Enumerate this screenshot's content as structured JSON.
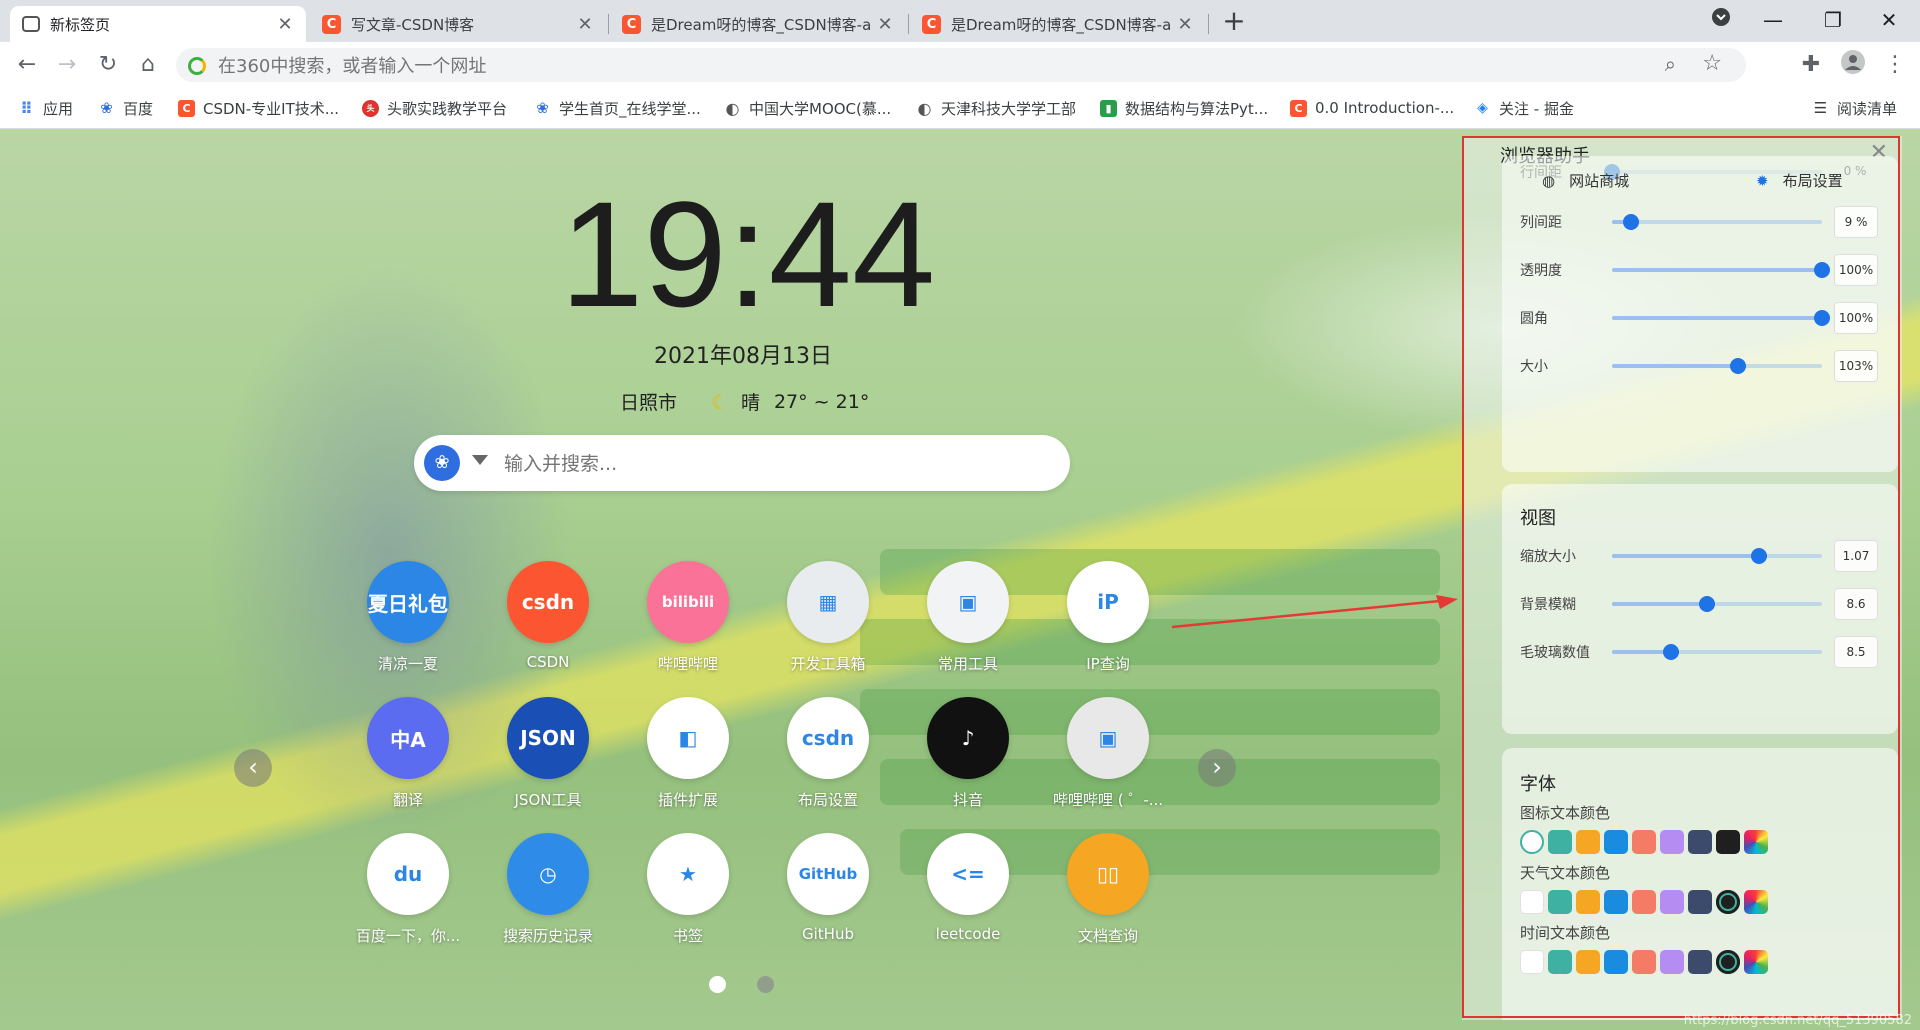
{
  "tabs": [
    {
      "title": "新标签页",
      "active": true
    },
    {
      "title": "写文章-CSDN博客",
      "active": false
    },
    {
      "title": "是Dream呀的博客_CSDN博客-a",
      "active": false
    },
    {
      "title": "是Dream呀的博客_CSDN博客-a",
      "active": false
    }
  ],
  "new_tab_label": "+",
  "toolbar": {
    "omnibox_placeholder": "在360中搜索，或者输入一个网址"
  },
  "bookmarks": [
    {
      "label": "应用",
      "icon": "apps-grid-icon",
      "color": "#4285f4"
    },
    {
      "label": "百度",
      "icon": "baidu-paw-icon",
      "color": "#2f6ee0"
    },
    {
      "label": "CSDN-专业IT技术...",
      "icon": "csdn-c-icon",
      "color": "#fc5531"
    },
    {
      "label": "头歌实践教学平台",
      "icon": "toge-icon",
      "color": "#e0322f"
    },
    {
      "label": "学生首页_在线学堂...",
      "icon": "paw-icon",
      "color": "#2f6ee0"
    },
    {
      "label": "中国大学MOOC(慕...",
      "icon": "mooc-icon",
      "color": "#555555"
    },
    {
      "label": "天津科技大学学工部",
      "icon": "globe-icon",
      "color": "#555555"
    },
    {
      "label": "数据结构与算法Pyt...",
      "icon": "book-icon",
      "color": "#2a9d4a"
    },
    {
      "label": "0.0 Introduction-...",
      "icon": "csdn-c-icon",
      "color": "#fc5531"
    },
    {
      "label": "关注 - 掘金",
      "icon": "juejin-icon",
      "color": "#1e80ff"
    }
  ],
  "reading_list_label": "阅读清单",
  "clock": {
    "time": "19:44",
    "date": "2021年08月13日"
  },
  "weather": {
    "city": "日照市",
    "condition": "晴",
    "temp": "27° ~ 21°"
  },
  "search": {
    "placeholder": "输入并搜索...",
    "engine_icon": "baidu-du-icon"
  },
  "apps": [
    {
      "label": "清凉一夏",
      "icon_text": "夏日礼包",
      "color": "#2c86e6"
    },
    {
      "label": "CSDN",
      "icon_text": "csdn",
      "color": "#fc5531"
    },
    {
      "label": "哔哩哔哩",
      "icon_text": "bilibili",
      "color": "#fb7299"
    },
    {
      "label": "开发工具箱",
      "icon_text": "▦",
      "color": "#e9ecef"
    },
    {
      "label": "常用工具",
      "icon_text": "▣",
      "color": "#f1f3f5"
    },
    {
      "label": "IP查询",
      "icon_text": "iP",
      "color": "#ffffff"
    },
    {
      "label": "翻译",
      "icon_text": "中A",
      "color": "#5b6cf0"
    },
    {
      "label": "JSON工具",
      "icon_text": "JSON",
      "color": "#1a4fb5"
    },
    {
      "label": "插件扩展",
      "icon_text": "◧",
      "color": "#ffffff"
    },
    {
      "label": "布局设置",
      "icon_text": "csdn",
      "color": "#ffffff"
    },
    {
      "label": "抖音",
      "icon_text": "♪",
      "color": "#111111"
    },
    {
      "label": "哔哩哔哩 ( ゜-...",
      "icon_text": "▣",
      "color": "#e8e8e8"
    },
    {
      "label": "百度一下，你...",
      "icon_text": "du",
      "color": "#ffffff"
    },
    {
      "label": "搜索历史记录",
      "icon_text": "◷",
      "color": "#2e8ce8"
    },
    {
      "label": "书签",
      "icon_text": "★",
      "color": "#ffffff"
    },
    {
      "label": "GitHub",
      "icon_text": "GitHub",
      "color": "#ffffff"
    },
    {
      "label": "leetcode",
      "icon_text": "<=",
      "color": "#ffffff"
    },
    {
      "label": "文档查询",
      "icon_text": "▯▯",
      "color": "#f5a623"
    }
  ],
  "pager": {
    "prev": "‹",
    "next": "›",
    "dots": 2,
    "active_dot": 0
  },
  "panel": {
    "title": "浏览器助手",
    "partial_row_label": "行间距",
    "partial_row_value": "0 %",
    "partial_row_level": 0,
    "links": [
      {
        "label": "网站商城",
        "icon": "globe-icon"
      },
      {
        "label": "布局设置",
        "icon": "gear-icon"
      }
    ],
    "layout_rows": [
      {
        "label": "列间距",
        "value": "9 %",
        "level": 0.09
      },
      {
        "label": "透明度",
        "value": "100%",
        "level": 1.0
      },
      {
        "label": "圆角",
        "value": "100%",
        "level": 1.0
      },
      {
        "label": "大小",
        "value": "103%",
        "level": 0.6
      }
    ],
    "view_title": "视图",
    "view_rows": [
      {
        "label": "缩放大小",
        "value": "1.07",
        "level": 0.7
      },
      {
        "label": "背景模糊",
        "value": "8.6",
        "level": 0.45
      },
      {
        "label": "毛玻璃数值",
        "value": "8.5",
        "level": 0.28
      }
    ],
    "font_title": "字体",
    "font_groups": [
      {
        "label": "图标文本颜色",
        "selected": 0
      },
      {
        "label": "天气文本颜色",
        "selected": 7
      },
      {
        "label": "时间文本颜色",
        "selected": 7
      }
    ],
    "swatch_colors": [
      "#ffffff",
      "#3fb1a3",
      "#f5a623",
      "#1a8ce0",
      "#f47c66",
      "#b48cf2",
      "#3c4a6b",
      "#1f1f1f"
    ]
  },
  "watermark": "https://blog.csdn.net/qq_51390582"
}
